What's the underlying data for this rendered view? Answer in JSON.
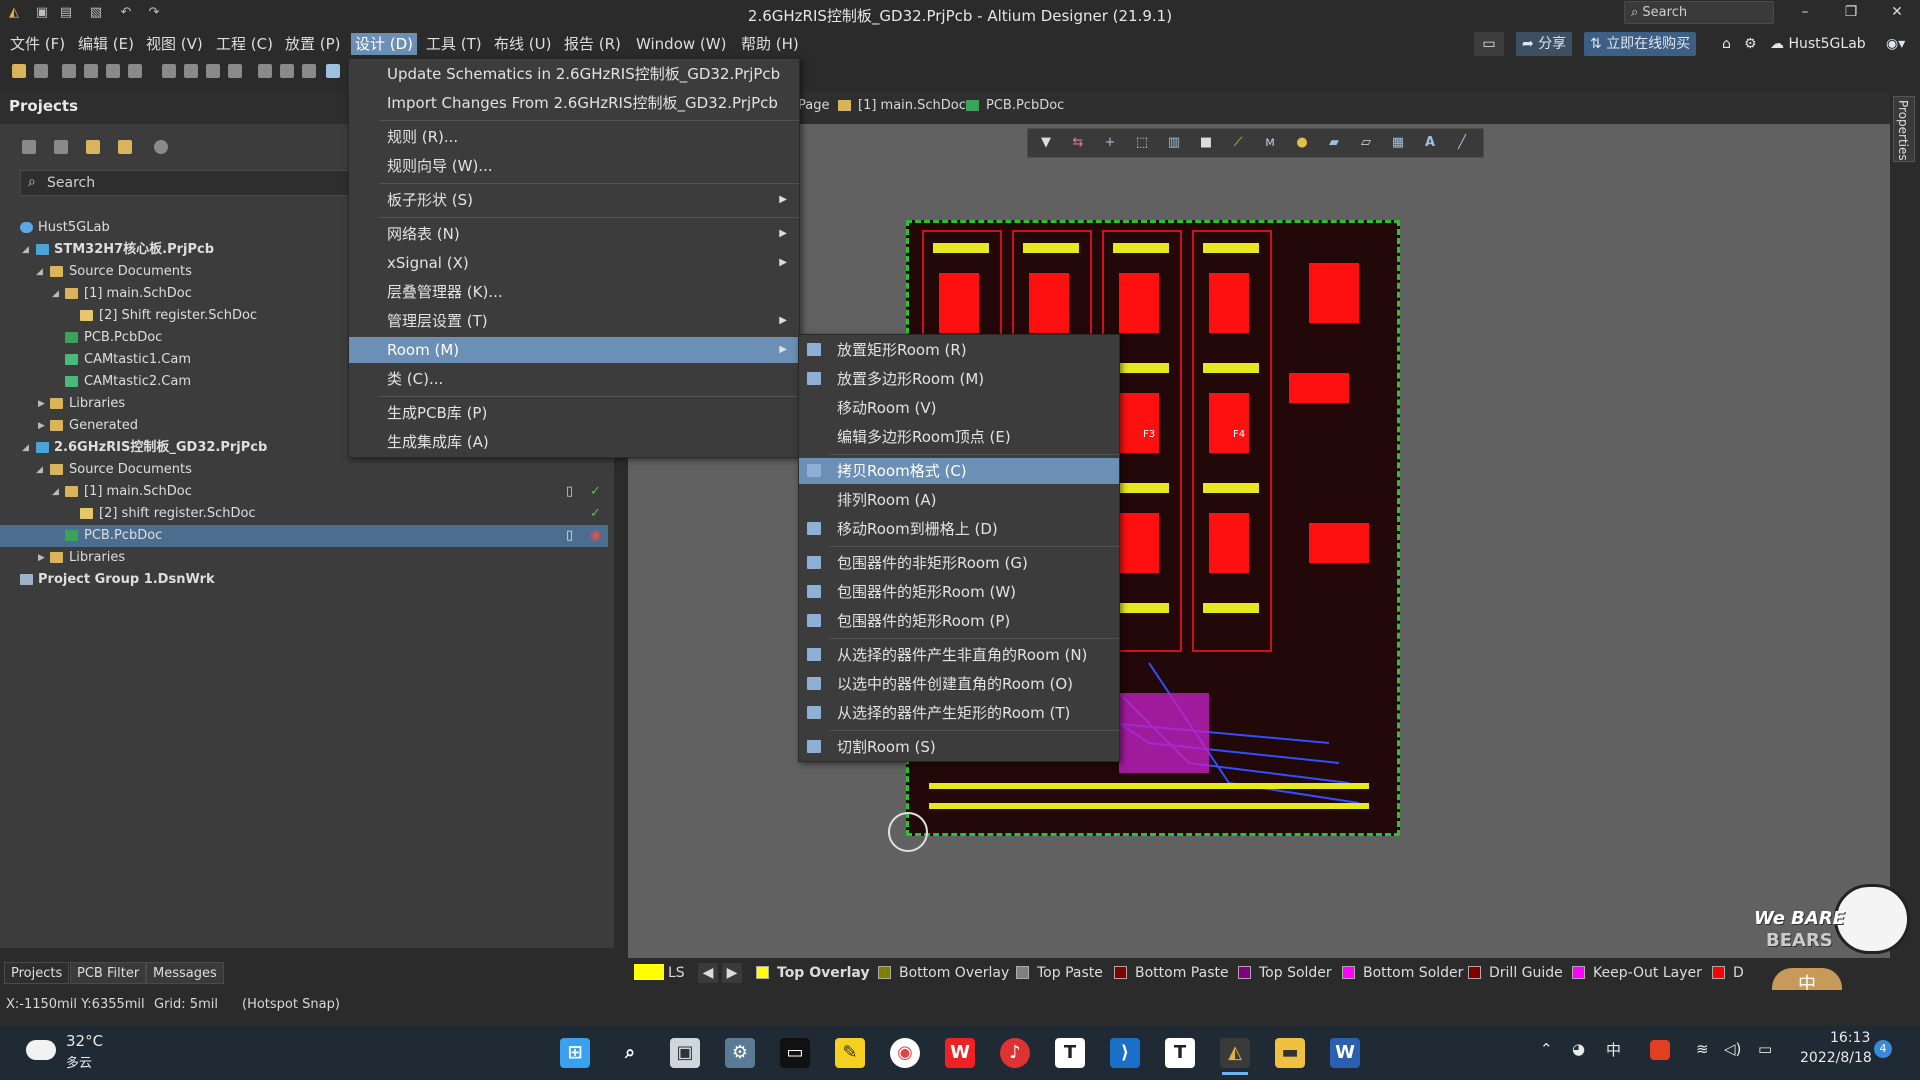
{
  "titlebar": {
    "title": "2.6GHzRIS控制板_GD32.PrjPcb - Altium Designer (21.9.1)",
    "search_label": "Search",
    "minimize": "–",
    "restore": "❐",
    "close": "✕"
  },
  "menubar": {
    "items": [
      "文件 (F)",
      "编辑 (E)",
      "视图 (V)",
      "工程 (C)",
      "放置 (P)",
      "设计 (D)",
      "工具 (T)",
      "布线 (U)",
      "报告 (R)",
      "Window (W)",
      "帮助 (H)"
    ],
    "share_label": "分享",
    "buy_label": "立即在线购买",
    "user_label": "Hust5GLab"
  },
  "projects_panel": {
    "title": "Projects",
    "search_placeholder": "Search",
    "tree": [
      {
        "label": "Hust5GLab",
        "icon": "cloud-icon"
      },
      {
        "label": "STM32H7核心板.PrjPcb",
        "icon": "project-icon"
      },
      {
        "label": "Source Documents",
        "icon": "folder-icon"
      },
      {
        "label": "[1] main.SchDoc",
        "icon": "folder-icon"
      },
      {
        "label": "[2] Shift register.SchDoc",
        "icon": "schematic-icon"
      },
      {
        "label": "PCB.PcbDoc",
        "icon": "pcb-icon"
      },
      {
        "label": "CAMtastic1.Cam",
        "icon": "cam-icon"
      },
      {
        "label": "CAMtastic2.Cam",
        "icon": "cam-icon"
      },
      {
        "label": "Libraries",
        "icon": "folder-icon"
      },
      {
        "label": "Generated",
        "icon": "folder-icon"
      },
      {
        "label": "2.6GHzRIS控制板_GD32.PrjPcb",
        "icon": "project-icon"
      },
      {
        "label": "Source Documents",
        "icon": "folder-icon"
      },
      {
        "label": "[1] main.SchDoc",
        "icon": "folder-icon"
      },
      {
        "label": "[2] shift register.SchDoc",
        "icon": "schematic-icon"
      },
      {
        "label": "PCB.PcbDoc",
        "icon": "pcb-icon"
      },
      {
        "label": "Libraries",
        "icon": "folder-icon"
      },
      {
        "label": "Project Group 1.DsnWrk",
        "icon": "group-icon"
      }
    ],
    "bottom_tabs": [
      "Projects",
      "PCB Filter",
      "Messages"
    ]
  },
  "doc_tabs": [
    "Page",
    "[1] main.SchDoc",
    "PCB.PcbDoc"
  ],
  "properties_tab": "Properties",
  "design_menu": {
    "items": [
      "Update Schematics in 2.6GHzRIS控制板_GD32.PrjPcb",
      "Import Changes From 2.6GHzRIS控制板_GD32.PrjPcb",
      "规则 (R)...",
      "规则向导 (W)...",
      "板子形状 (S)",
      "网络表 (N)",
      "xSignal (X)",
      "层叠管理器 (K)...",
      "管理层设置 (T)",
      "Room (M)",
      "类 (C)...",
      "生成PCB库 (P)",
      "生成集成库 (A)"
    ]
  },
  "room_menu": {
    "items": [
      "放置矩形Room (R)",
      "放置多边形Room (M)",
      "移动Room (V)",
      "编辑多边形Room顶点 (E)",
      "拷贝Room格式 (C)",
      "排列Room (A)",
      "移动Room到栅格上 (D)",
      "包围器件的非矩形Room (G)",
      "包围器件的矩形Room (W)",
      "包围器件的矩形Room (P)",
      "从选择的器件产生非直角的Room (N)",
      "以选中的器件创建直角的Room (O)",
      "从选择的器件产生矩形的Room (T)",
      "切割Room (S)"
    ]
  },
  "board_labels": [
    "F3",
    "F4"
  ],
  "layers": {
    "ls_label": "LS",
    "items": [
      {
        "name": "Top Overlay",
        "color": "#ffff00"
      },
      {
        "name": "Bottom Overlay",
        "color": "#808000"
      },
      {
        "name": "Top Paste",
        "color": "#808080"
      },
      {
        "name": "Bottom Paste",
        "color": "#800000"
      },
      {
        "name": "Top Solder",
        "color": "#800080"
      },
      {
        "name": "Bottom Solder",
        "color": "#ff00ff"
      },
      {
        "name": "Drill Guide",
        "color": "#800000"
      },
      {
        "name": "Keep-Out Layer",
        "color": "#ff00ff"
      },
      {
        "name": "D",
        "color": "#ff0000"
      }
    ]
  },
  "statusbar": {
    "coords": "X:-1150mil Y:6355mil",
    "grid": "Grid: 5mil",
    "snap": "(Hotspot Snap)"
  },
  "taskbar": {
    "temperature": "32°C",
    "weather": "多云",
    "time": "16:13",
    "date": "2022/8/18",
    "ime": "中",
    "notification_count": "4",
    "apps": [
      "windows-start-icon",
      "search-icon",
      "task-view-icon",
      "settings-icon",
      "terminal-icon",
      "sticky-notes-icon",
      "chrome-icon",
      "wps-icon",
      "netease-music-icon",
      "typora-icon",
      "vscode-icon",
      "typora-icon",
      "altium-icon",
      "explorer-icon",
      "word-icon"
    ]
  },
  "sticker": {
    "line1": "We BARE",
    "line2": "BEARS",
    "ime": "中"
  }
}
